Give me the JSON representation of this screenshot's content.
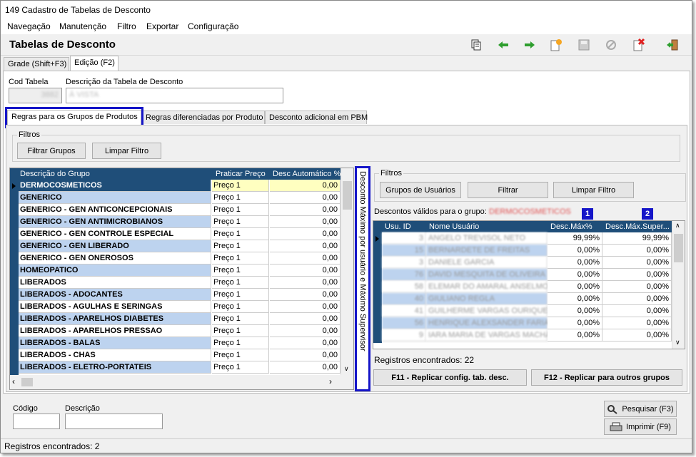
{
  "window": {
    "title": "149 Cadastro de Tabelas de Desconto"
  },
  "menu": [
    {
      "label": "Navegação"
    },
    {
      "label": "Manutenção"
    },
    {
      "label": "Filtro"
    },
    {
      "label": "Exportar"
    },
    {
      "label": "Configuração"
    }
  ],
  "header": {
    "title": "Tabelas de Desconto"
  },
  "toolbar": {
    "icons": [
      "copy-icon",
      "arrow-left-icon",
      "arrow-right-icon",
      "new-icon",
      "save-icon",
      "cancel-icon",
      "delete-icon",
      "exit-icon"
    ]
  },
  "main_tabs": [
    "Grade (Shift+F3)",
    "Edição (F2)"
  ],
  "form": {
    "cod_label": "Cod Tabela",
    "cod_value": "3882",
    "desc_label": "Descrição da Tabela de Desconto",
    "desc_value": "À VISTA"
  },
  "sub_tabs": [
    "Regras para os Grupos de Produtos",
    "Regras diferenciadas por Produto",
    "Desconto adicional em PBM"
  ],
  "filters": {
    "legend": "Filtros",
    "btn_filtrar": "Filtrar Grupos",
    "btn_limpar": "Limpar Filtro"
  },
  "groups_grid": {
    "columns": [
      "Descrição do Grupo",
      "Praticar Preço",
      "Desc Automático %"
    ],
    "rows": [
      [
        "DERMOCOSMETICOS",
        "Preço 1",
        "0,00"
      ],
      [
        "GENERICO",
        "Preço 1",
        "0,00"
      ],
      [
        "GENERICO - GEN ANTICONCEPCIONAIS",
        "Preço 1",
        "0,00"
      ],
      [
        "GENERICO - GEN ANTIMICROBIANOS",
        "Preço 1",
        "0,00"
      ],
      [
        "GENERICO - GEN CONTROLE ESPECIAL",
        "Preço 1",
        "0,00"
      ],
      [
        "GENERICO - GEN LIBERADO",
        "Preço 1",
        "0,00"
      ],
      [
        "GENERICO - GEN ONEROSOS",
        "Preço 1",
        "0,00"
      ],
      [
        "HOMEOPATICO",
        "Preço 1",
        "0,00"
      ],
      [
        "LIBERADOS",
        "Preço 1",
        "0,00"
      ],
      [
        "LIBERADOS - ADOCANTES",
        "Preço 1",
        "0,00"
      ],
      [
        "LIBERADOS - AGULHAS E SERINGAS",
        "Preço 1",
        "0,00"
      ],
      [
        "LIBERADOS - APARELHOS DIABETES",
        "Preço 1",
        "0,00"
      ],
      [
        "LIBERADOS - APARELHOS PRESSAO",
        "Preço 1",
        "0,00"
      ],
      [
        "LIBERADOS - BALAS",
        "Preço 1",
        "0,00"
      ],
      [
        "LIBERADOS - CHAS",
        "Preço 1",
        "0,00"
      ],
      [
        "LIBERADOS - ELETRO-PORTATEIS",
        "Preço 1",
        "0,00"
      ]
    ]
  },
  "vertical_label": "Desconto Máximo por usuário e Máximo Supervisor",
  "user_filters": {
    "legend": "Filtros",
    "btn_grupos": "Grupos de Usuários",
    "btn_filtrar": "Filtrar",
    "btn_limpar": "Limpar Filtro"
  },
  "valid_label": "Descontos válidos para o grupo:",
  "valid_group": "DERMOCOSMETICOS",
  "badges": [
    "1",
    "2"
  ],
  "users_grid": {
    "columns": [
      "Usu. ID",
      "Nome Usuário",
      "Desc.Máx%",
      "Desc.Máx.Super..."
    ],
    "rows": [
      [
        "3",
        "ANGELO TREVISOL NETO",
        "99,99%",
        "99,99%"
      ],
      [
        "15",
        "BERNARDETE DE FREITAS",
        "0,00%",
        "0,00%"
      ],
      [
        "3",
        "DANIELE GARCIA",
        "0,00%",
        "0,00%"
      ],
      [
        "76",
        "DAVID MESQUITA DE OLIVEIRA",
        "0,00%",
        "0,00%"
      ],
      [
        "58",
        "ELEMAR DO AMARAL ANSELMO",
        "0,00%",
        "0,00%"
      ],
      [
        "40",
        "GIULIANO REGLA",
        "0,00%",
        "0,00%"
      ],
      [
        "41",
        "GUILHERME VARGAS OURIQUES",
        "0,00%",
        "0,00%"
      ],
      [
        "56",
        "HENRIQUE ALEXSANDER FARIAS",
        "0,00%",
        "0,00%"
      ],
      [
        "9",
        "IARA MARIA DE VARGAS MACHADO",
        "0,00%",
        "0,00%"
      ]
    ]
  },
  "users_count": "Registros encontrados: 22",
  "btn_f11": "F11 - Replicar config. tab. desc.",
  "btn_f12": "F12 - Replicar para outros grupos",
  "bottom": {
    "codigo_label": "Código",
    "descricao_label": "Descrição",
    "btn_pesquisar": "Pesquisar (F3)",
    "btn_imprimir": "Imprimir (F9)"
  },
  "status": "Registros encontrados: 2"
}
